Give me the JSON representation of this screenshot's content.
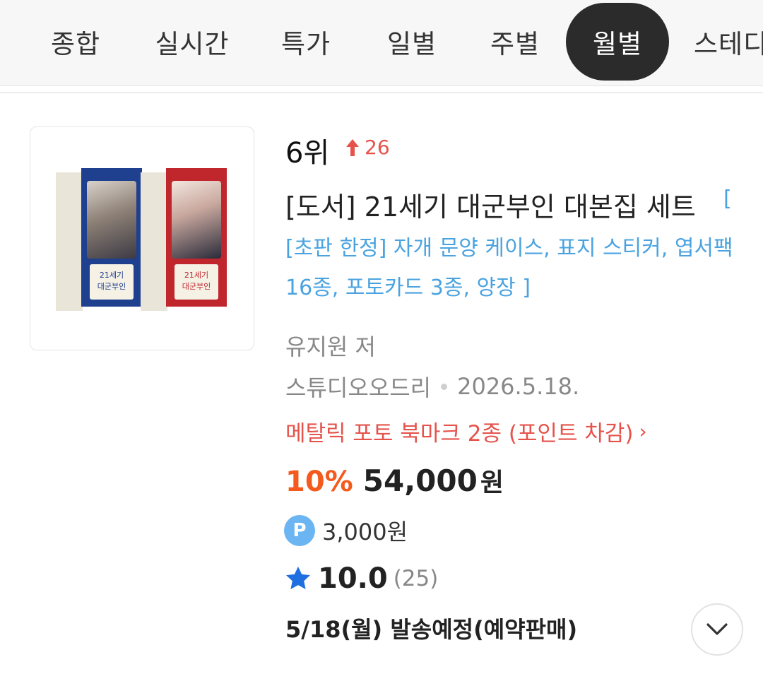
{
  "tabs": [
    {
      "label": "종합"
    },
    {
      "label": "실시간"
    },
    {
      "label": "특가"
    },
    {
      "label": "일별"
    },
    {
      "label": "주별"
    },
    {
      "label": "월별",
      "active": true
    },
    {
      "label": "스테디"
    }
  ],
  "product": {
    "rank": "6위",
    "rank_change": "26",
    "rank_change_direction": "up",
    "title": "[도서] 21세기 대군부인 대본집 세트",
    "title_bracket": "[",
    "subtitle": "[초판 한정] 자개 문양 케이스, 표지 스티커, 엽서팩 16종, 포토카드 3종, 양장 ]",
    "author": "유지원 저",
    "publisher": "스튜디오오드리",
    "pub_date": "2026.5.18.",
    "promo": "메탈릭 포토 북마크 2종 (포인트 차감)",
    "promo_arrow": "›",
    "discount": "10%",
    "price": "54,000",
    "price_unit": "원",
    "point_badge": "P",
    "point": "3,000원",
    "rating": "10.0",
    "review_count": "(25)",
    "shipping": "5/18(월) 발송예정(예약판매)",
    "cover_texts": [
      "21세기",
      "대군부인"
    ]
  },
  "colors": {
    "active_tab_bg": "#2b2b2b",
    "discount": "#f45a1d",
    "rank_up": "#e5534b",
    "subtitle": "#4aa3e0",
    "star": "#1f6fe0",
    "point_badge": "#6bb6f2",
    "cover_blue": "#1f3f8f",
    "cover_red": "#c0272d"
  },
  "icons": {
    "rank_change": "arrow-up-icon",
    "rating": "star-icon",
    "expand": "chevron-down-icon",
    "point": "point-badge-icon"
  }
}
